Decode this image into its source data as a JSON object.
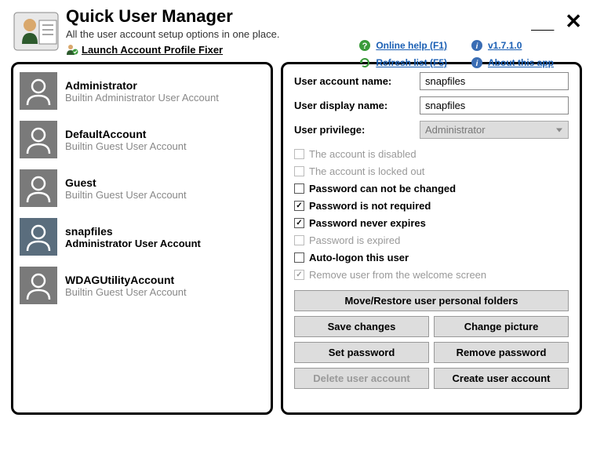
{
  "app": {
    "title": "Quick User Manager",
    "subtitle": "All the user account setup options in one place.",
    "launch_link": "Launch Account Profile Fixer"
  },
  "header_links": {
    "help": "Online help (F1)",
    "version": "v1.7.1.0",
    "refresh": "Refresh list (F5)",
    "about": "About this app"
  },
  "users": [
    {
      "name": "Administrator",
      "desc": "Builtin Administrator User Account",
      "selected": false
    },
    {
      "name": "DefaultAccount",
      "desc": "Builtin Guest User Account",
      "selected": false
    },
    {
      "name": "Guest",
      "desc": "Builtin Guest User Account",
      "selected": false
    },
    {
      "name": "snapfiles",
      "desc": "Administrator User Account",
      "selected": true
    },
    {
      "name": "WDAGUtilityAccount",
      "desc": "Builtin Guest User Account",
      "selected": false
    }
  ],
  "form": {
    "account_name_label": "User account name:",
    "account_name_value": "snapfiles",
    "display_name_label": "User display name:",
    "display_name_value": "snapfiles",
    "privilege_label": "User privilege:",
    "privilege_value": "Administrator"
  },
  "checks": [
    {
      "label": "The account is disabled",
      "checked": false,
      "enabled": false
    },
    {
      "label": "The account is locked out",
      "checked": false,
      "enabled": false
    },
    {
      "label": "Password can not be changed",
      "checked": false,
      "enabled": true
    },
    {
      "label": "Password is not required",
      "checked": true,
      "enabled": true
    },
    {
      "label": "Password never expires",
      "checked": true,
      "enabled": true
    },
    {
      "label": "Password is expired",
      "checked": false,
      "enabled": false
    },
    {
      "label": "Auto-logon this user",
      "checked": false,
      "enabled": true
    },
    {
      "label": "Remove user from the welcome screen",
      "checked": true,
      "enabled": false
    }
  ],
  "buttons": {
    "move_restore": "Move/Restore user personal folders",
    "save": "Save changes",
    "change_pic": "Change picture",
    "set_pwd": "Set password",
    "remove_pwd": "Remove password",
    "delete": "Delete user account",
    "create": "Create user account"
  }
}
